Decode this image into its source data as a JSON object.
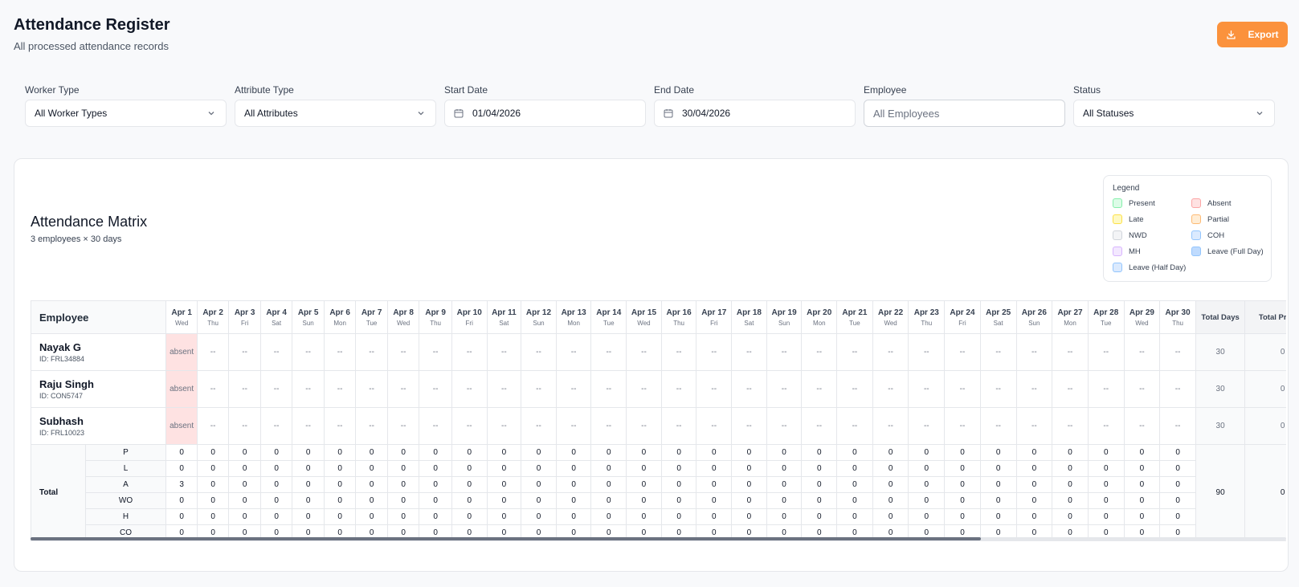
{
  "header": {
    "title": "Attendance Register",
    "subtitle": "All processed attendance records",
    "export_label": "Export"
  },
  "filters": [
    {
      "label": "Worker Type",
      "value": "All Worker Types",
      "kind": "select"
    },
    {
      "label": "Attribute Type",
      "value": "All Attributes",
      "kind": "select"
    },
    {
      "label": "Start Date",
      "value": "01/04/2026",
      "kind": "date"
    },
    {
      "label": "End Date",
      "value": "30/04/2026",
      "kind": "date"
    },
    {
      "label": "Employee",
      "placeholder": "All Employees",
      "kind": "input"
    },
    {
      "label": "Status",
      "value": "All Statuses",
      "kind": "select"
    }
  ],
  "matrix": {
    "title": "Attendance Matrix",
    "subtitle": "3 employees × 30 days"
  },
  "legend": {
    "title": "Legend",
    "items": [
      {
        "label": "Present",
        "fill": "#dcfce7",
        "border": "#86efac"
      },
      {
        "label": "Absent",
        "fill": "#fee2e2",
        "border": "#fca5a5"
      },
      {
        "label": "Late",
        "fill": "#fef9c3",
        "border": "#fde047"
      },
      {
        "label": "Partial",
        "fill": "#ffedd5",
        "border": "#fdba74"
      },
      {
        "label": "NWD",
        "fill": "#f3f4f6",
        "border": "#d1d5db"
      },
      {
        "label": "COH",
        "fill": "#dbeafe",
        "border": "#93c5fd"
      },
      {
        "label": "MH",
        "fill": "#f3e8ff",
        "border": "#d8b4fe"
      },
      {
        "label": "Leave (Full Day)",
        "fill": "#bfdbfe",
        "border": "#93c5fd"
      },
      {
        "label": "Leave (Half Day)",
        "fill": "#dbeafe",
        "border": "#93c5fd"
      }
    ]
  },
  "table": {
    "employee_header": "Employee",
    "days": [
      {
        "date": "Apr 1",
        "dow": "Wed"
      },
      {
        "date": "Apr 2",
        "dow": "Thu"
      },
      {
        "date": "Apr 3",
        "dow": "Fri"
      },
      {
        "date": "Apr 4",
        "dow": "Sat"
      },
      {
        "date": "Apr 5",
        "dow": "Sun"
      },
      {
        "date": "Apr 6",
        "dow": "Mon"
      },
      {
        "date": "Apr 7",
        "dow": "Tue"
      },
      {
        "date": "Apr 8",
        "dow": "Wed"
      },
      {
        "date": "Apr 9",
        "dow": "Thu"
      },
      {
        "date": "Apr 10",
        "dow": "Fri"
      },
      {
        "date": "Apr 11",
        "dow": "Sat"
      },
      {
        "date": "Apr 12",
        "dow": "Sun"
      },
      {
        "date": "Apr 13",
        "dow": "Mon"
      },
      {
        "date": "Apr 14",
        "dow": "Tue"
      },
      {
        "date": "Apr 15",
        "dow": "Wed"
      },
      {
        "date": "Apr 16",
        "dow": "Thu"
      },
      {
        "date": "Apr 17",
        "dow": "Fri"
      },
      {
        "date": "Apr 18",
        "dow": "Sat"
      },
      {
        "date": "Apr 19",
        "dow": "Sun"
      },
      {
        "date": "Apr 20",
        "dow": "Mon"
      },
      {
        "date": "Apr 21",
        "dow": "Tue"
      },
      {
        "date": "Apr 22",
        "dow": "Wed"
      },
      {
        "date": "Apr 23",
        "dow": "Thu"
      },
      {
        "date": "Apr 24",
        "dow": "Fri"
      },
      {
        "date": "Apr 25",
        "dow": "Sat"
      },
      {
        "date": "Apr 26",
        "dow": "Sun"
      },
      {
        "date": "Apr 27",
        "dow": "Mon"
      },
      {
        "date": "Apr 28",
        "dow": "Tue"
      },
      {
        "date": "Apr 29",
        "dow": "Wed"
      },
      {
        "date": "Apr 30",
        "dow": "Thu"
      }
    ],
    "summary_headers": [
      "Total Days",
      "Total Present"
    ],
    "employees": [
      {
        "name": "Nayak G",
        "id": "ID: FRL34884",
        "days": [
          "absent",
          "--",
          "--",
          "--",
          "--",
          "--",
          "--",
          "--",
          "--",
          "--",
          "--",
          "--",
          "--",
          "--",
          "--",
          "--",
          "--",
          "--",
          "--",
          "--",
          "--",
          "--",
          "--",
          "--",
          "--",
          "--",
          "--",
          "--",
          "--",
          "--"
        ],
        "total_days": "30",
        "total_present": "0"
      },
      {
        "name": "Raju Singh",
        "id": "ID: CON5747",
        "days": [
          "absent",
          "--",
          "--",
          "--",
          "--",
          "--",
          "--",
          "--",
          "--",
          "--",
          "--",
          "--",
          "--",
          "--",
          "--",
          "--",
          "--",
          "--",
          "--",
          "--",
          "--",
          "--",
          "--",
          "--",
          "--",
          "--",
          "--",
          "--",
          "--",
          "--"
        ],
        "total_days": "30",
        "total_present": "0"
      },
      {
        "name": "Subhash",
        "id": "ID: FRL10023",
        "days": [
          "absent",
          "--",
          "--",
          "--",
          "--",
          "--",
          "--",
          "--",
          "--",
          "--",
          "--",
          "--",
          "--",
          "--",
          "--",
          "--",
          "--",
          "--",
          "--",
          "--",
          "--",
          "--",
          "--",
          "--",
          "--",
          "--",
          "--",
          "--",
          "--",
          "--"
        ],
        "total_days": "30",
        "total_present": "0"
      }
    ],
    "totals": {
      "label": "Total",
      "total_days": "90",
      "total_present": "0",
      "rows": [
        {
          "code": "P",
          "values": [
            "0",
            "0",
            "0",
            "0",
            "0",
            "0",
            "0",
            "0",
            "0",
            "0",
            "0",
            "0",
            "0",
            "0",
            "0",
            "0",
            "0",
            "0",
            "0",
            "0",
            "0",
            "0",
            "0",
            "0",
            "0",
            "0",
            "0",
            "0",
            "0",
            "0"
          ]
        },
        {
          "code": "L",
          "values": [
            "0",
            "0",
            "0",
            "0",
            "0",
            "0",
            "0",
            "0",
            "0",
            "0",
            "0",
            "0",
            "0",
            "0",
            "0",
            "0",
            "0",
            "0",
            "0",
            "0",
            "0",
            "0",
            "0",
            "0",
            "0",
            "0",
            "0",
            "0",
            "0",
            "0"
          ]
        },
        {
          "code": "A",
          "values": [
            "3",
            "0",
            "0",
            "0",
            "0",
            "0",
            "0",
            "0",
            "0",
            "0",
            "0",
            "0",
            "0",
            "0",
            "0",
            "0",
            "0",
            "0",
            "0",
            "0",
            "0",
            "0",
            "0",
            "0",
            "0",
            "0",
            "0",
            "0",
            "0",
            "0"
          ]
        },
        {
          "code": "WO",
          "values": [
            "0",
            "0",
            "0",
            "0",
            "0",
            "0",
            "0",
            "0",
            "0",
            "0",
            "0",
            "0",
            "0",
            "0",
            "0",
            "0",
            "0",
            "0",
            "0",
            "0",
            "0",
            "0",
            "0",
            "0",
            "0",
            "0",
            "0",
            "0",
            "0",
            "0"
          ]
        },
        {
          "code": "H",
          "values": [
            "0",
            "0",
            "0",
            "0",
            "0",
            "0",
            "0",
            "0",
            "0",
            "0",
            "0",
            "0",
            "0",
            "0",
            "0",
            "0",
            "0",
            "0",
            "0",
            "0",
            "0",
            "0",
            "0",
            "0",
            "0",
            "0",
            "0",
            "0",
            "0",
            "0"
          ]
        },
        {
          "code": "CO",
          "values": [
            "0",
            "0",
            "0",
            "0",
            "0",
            "0",
            "0",
            "0",
            "0",
            "0",
            "0",
            "0",
            "0",
            "0",
            "0",
            "0",
            "0",
            "0",
            "0",
            "0",
            "0",
            "0",
            "0",
            "0",
            "0",
            "0",
            "0",
            "0",
            "0",
            "0"
          ]
        }
      ]
    }
  }
}
